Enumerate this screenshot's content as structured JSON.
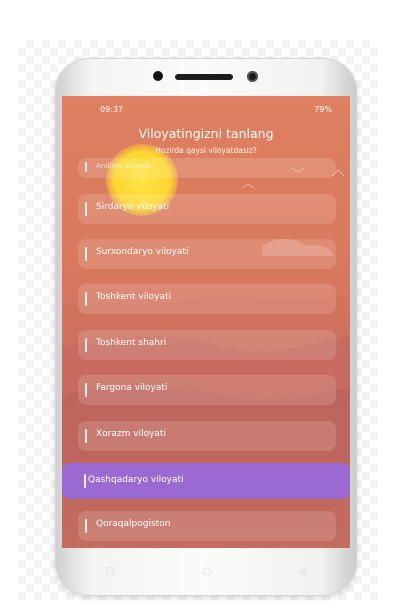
{
  "status": {
    "time": "09:37",
    "right": "79%"
  },
  "header": {
    "title": "Viloyatingizni tanlang",
    "subtitle": "Hozirda qaysi viloyatdasiz?"
  },
  "regions": [
    {
      "label": "Andijon viloyati"
    },
    {
      "label": "Sirdaryo viloyati"
    },
    {
      "label": "Surxondaryo viloyati"
    },
    {
      "label": "Toshkent viloyati"
    },
    {
      "label": "Toshkent shahri"
    },
    {
      "label": "Fargona viloyati"
    },
    {
      "label": "Xorazm viloyati"
    },
    {
      "label": "Qashqadaryo viloyati",
      "selected": true
    },
    {
      "label": "Qoraqalpogiston"
    }
  ],
  "navbar": {
    "square": "□",
    "circle": "○",
    "back": "◁"
  },
  "colors": {
    "accent": "#9a6ad2",
    "background": "#df8060"
  }
}
